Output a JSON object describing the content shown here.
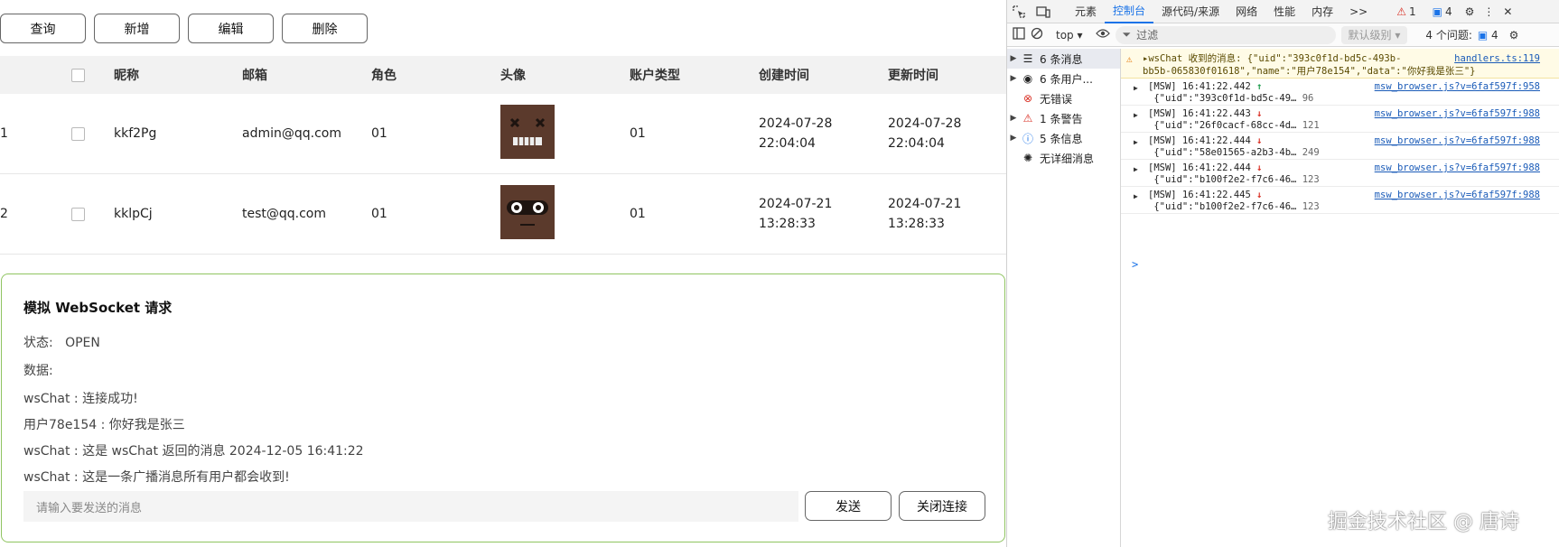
{
  "toolbar": {
    "query": "查询",
    "add": "新增",
    "edit": "编辑",
    "delete": "删除"
  },
  "table": {
    "headers": [
      "",
      "",
      "昵称",
      "邮箱",
      "角色",
      "头像",
      "账户类型",
      "创建时间",
      "更新时间"
    ],
    "rows": [
      {
        "index": "1",
        "nickname": "kkf2Pg",
        "email": "admin@qq.com",
        "role": "01",
        "avatar": "avatar-icon",
        "account_type": "01",
        "created_date": "2024-07-28",
        "created_time": "22:04:04",
        "updated_date": "2024-07-28",
        "updated_time": "22:04:04"
      },
      {
        "index": "2",
        "nickname": "kklpCj",
        "email": "test@qq.com",
        "role": "01",
        "avatar": "avatar-icon",
        "account_type": "01",
        "created_date": "2024-07-21",
        "created_time": "13:28:33",
        "updated_date": "2024-07-21",
        "updated_time": "13:28:33"
      }
    ]
  },
  "ws": {
    "title": "模拟 WebSocket 请求",
    "status_label": "状态:",
    "status_value": "OPEN",
    "data_label": "数据:",
    "messages": [
      "wsChat : 连接成功!",
      "用户78e154 : 你好我是张三",
      "wsChat : 这是 wsChat 返回的消息 2024-12-05 16:41:22",
      "wsChat : 这是一条广播消息所有用户都会收到!"
    ],
    "input_placeholder": "请输入要发送的消息",
    "send": "发送",
    "close": "关闭连接"
  },
  "devtools": {
    "tabs": [
      "元素",
      "控制台",
      "源代码/来源",
      "网络",
      "性能",
      "内存"
    ],
    "more": ">>",
    "warn_count": "1",
    "msg_count": "4",
    "context": "top",
    "filter_placeholder": "过滤",
    "level": "默认级别",
    "issues_label": "4 个问题:",
    "issues_count": "4",
    "sidebar": [
      {
        "label": "6 条消息",
        "icon": "list-icon"
      },
      {
        "label": "6 条用户...",
        "icon": "user-icon"
      },
      {
        "label": "无错误",
        "icon": "error-icon"
      },
      {
        "label": "1 条警告",
        "icon": "warning-icon"
      },
      {
        "label": "5 条信息",
        "icon": "info-icon"
      },
      {
        "label": "无详细消息",
        "icon": "bug-icon"
      }
    ],
    "warning": {
      "line1": "▸wsChat 收到的消息: {\"uid\":\"393c0f1d-bd5c-493b-",
      "line2": "bb5b-065830f01618\",\"name\":\"用户78e154\",\"data\":\"你好我是张三\"}",
      "source": "handlers.ts:119"
    },
    "logs": [
      {
        "time": "[MSW] 16:41:22.442",
        "dir": "up",
        "body": "{\"uid\":\"393c0f1d-bd5c-49…",
        "num": "96",
        "source": "msw_browser.js?v=6faf597f:958"
      },
      {
        "time": "[MSW] 16:41:22.443",
        "dir": "down",
        "body": "{\"uid\":\"26f0cacf-68cc-4d…",
        "num": "121",
        "source": "msw_browser.js?v=6faf597f:988"
      },
      {
        "time": "[MSW] 16:41:22.444",
        "dir": "down",
        "body": "{\"uid\":\"58e01565-a2b3-4b…",
        "num": "249",
        "source": "msw_browser.js?v=6faf597f:988"
      },
      {
        "time": "[MSW] 16:41:22.444",
        "dir": "down",
        "body": "{\"uid\":\"b100f2e2-f7c6-46…",
        "num": "123",
        "source": "msw_browser.js?v=6faf597f:988"
      },
      {
        "time": "[MSW] 16:41:22.445",
        "dir": "down",
        "body": "{\"uid\":\"b100f2e2-f7c6-46…",
        "num": "123",
        "source": "msw_browser.js?v=6faf597f:988"
      }
    ],
    "prompt": ">"
  },
  "watermark": "掘金技术社区 @ 唐诗"
}
